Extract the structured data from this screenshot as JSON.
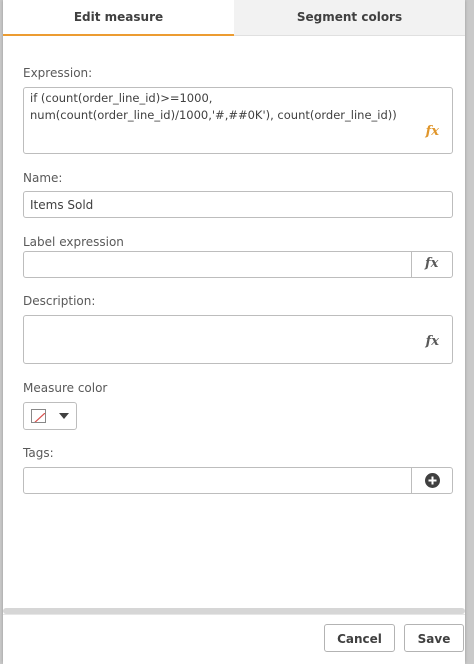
{
  "tabs": [
    {
      "label": "Edit measure",
      "active": true
    },
    {
      "label": "Segment colors",
      "active": false
    }
  ],
  "expression": {
    "label": "Expression:",
    "value": "if (count(order_line_id)>=1000,\nnum(count(order_line_id)/1000,'#,##0K'), count(order_line_id))",
    "icon": "fx-icon"
  },
  "name": {
    "label": "Name:",
    "value": "Items Sold"
  },
  "label_expression": {
    "label": "Label expression",
    "value": "",
    "icon": "fx-icon"
  },
  "description": {
    "label": "Description:",
    "value": "",
    "icon": "fx-icon"
  },
  "measure_color": {
    "label": "Measure color",
    "icon": "no-color-swatch-icon"
  },
  "tags": {
    "label": "Tags:",
    "value": "",
    "icon": "plus-circle-icon"
  },
  "footer": {
    "cancel_label": "Cancel",
    "save_label": "Save"
  },
  "colors": {
    "accent": "#ec9c31",
    "fx_expression": "#e0962b"
  }
}
